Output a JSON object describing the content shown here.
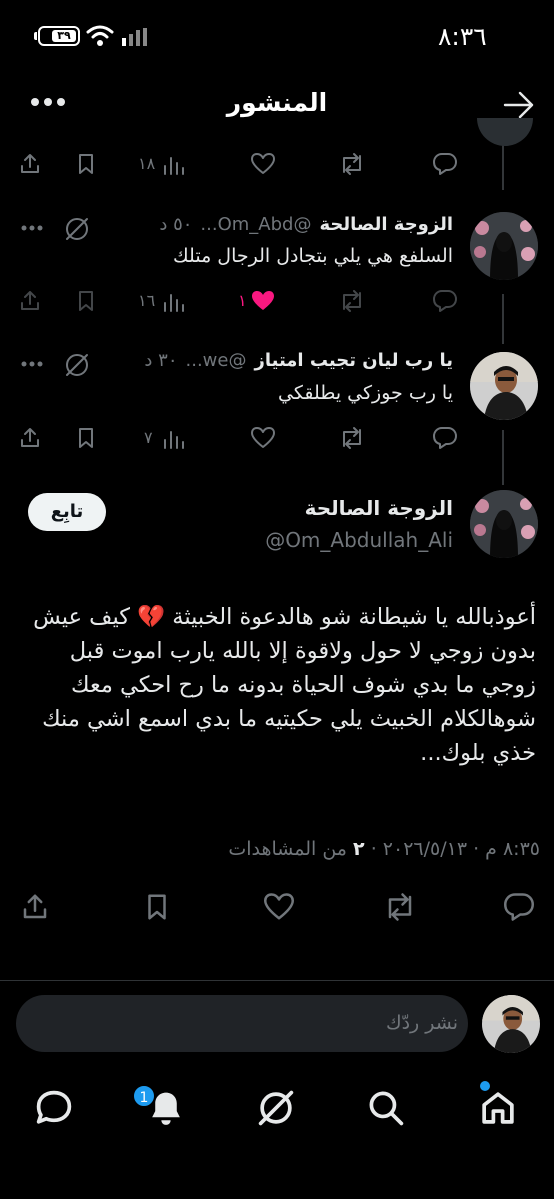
{
  "status_bar": {
    "time": "٨:٣٦",
    "battery": "٣٩"
  },
  "header": {
    "title": "المنشور"
  },
  "replies": [
    {
      "views": "١٨"
    },
    {
      "name": "الزوجة الصالحة",
      "handle": "@Om_Abd...",
      "time": "٥٠ د",
      "text": "السلفع هي يلي بتجادل الرجال متلك",
      "views": "١٦",
      "likes": "١"
    },
    {
      "name": "يا رب ليان تجيب امتياز",
      "handle": "@we...",
      "time": "٣٠ د",
      "text": "يا رب جوزكي يطلقكي",
      "views": "٧"
    }
  ],
  "main_post": {
    "name": "الزوجة الصالحة",
    "handle": "@Om_Abdullah_Ali",
    "follow_label": "تابِع",
    "text": "أعوذبالله يا شيطانة شو هالدعوة الخبيثة 💔 كيف عيش بدون زوجي لا حول ولاقوة إلا بالله يارب اموت قبل زوجي ما بدي شوف الحياة بدونه ما رح احكي معك شوهالكلام الخبيث يلي حكيتيه ما بدي اسمع اشي منك خذي بلوك...",
    "date_time": "٨:٣٥ م · ٢٠٢٦/٥/١٣ ·",
    "views_count": "٢",
    "views_label": "من المشاهدات"
  },
  "reply_composer": {
    "placeholder": "نشر ردّك"
  },
  "bottom_nav": {
    "notifications_badge": "1"
  },
  "colors": {
    "accent": "#1d9bf0",
    "like": "#f91880",
    "background": "#000000",
    "muted": "#71767b"
  }
}
